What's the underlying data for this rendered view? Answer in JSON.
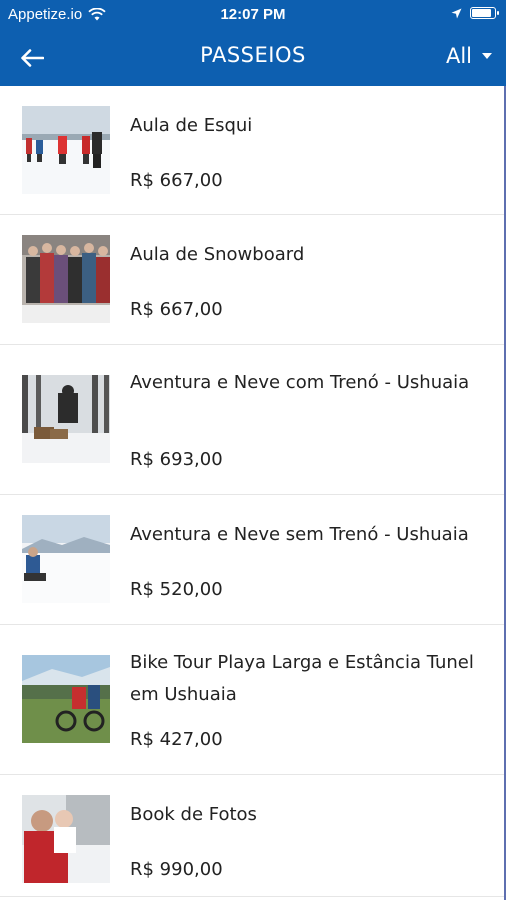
{
  "status_bar": {
    "carrier": "Appetize.io",
    "time": "12:07 PM"
  },
  "nav": {
    "title": "PASSEIOS",
    "filter_label": "All",
    "back_icon": "arrow-left-icon"
  },
  "items": [
    {
      "title": "Aula de Esqui",
      "price": "R$ 667,00"
    },
    {
      "title": "Aula de Snowboard",
      "price": "R$ 667,00"
    },
    {
      "title": "Aventura e Neve com Trenó - Ushuaia",
      "price": "R$ 693,00"
    },
    {
      "title": "Aventura e Neve sem Trenó - Ushuaia",
      "price": "R$ 520,00"
    },
    {
      "title": "Bike Tour Playa Larga e Estância Tunel em Ushuaia",
      "price": "R$ 427,00"
    },
    {
      "title": "Book de Fotos",
      "price": "R$ 990,00"
    }
  ],
  "colors": {
    "header": "#0d5fb0",
    "text": "#222222",
    "divider": "#e6e6e6"
  }
}
